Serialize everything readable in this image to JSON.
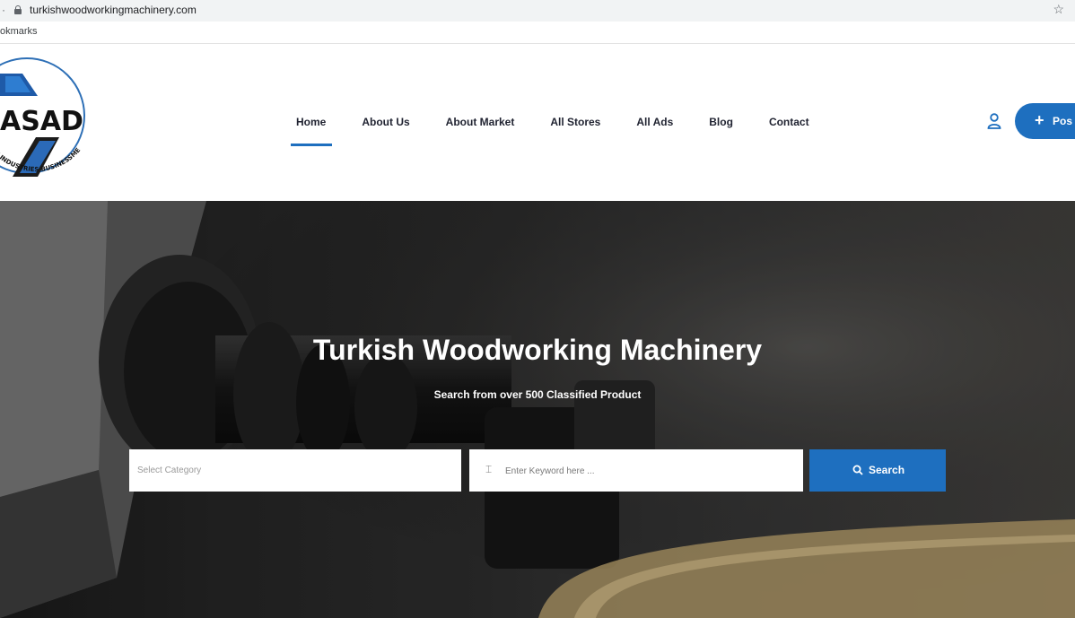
{
  "browser": {
    "url": "turkishwoodworkingmachinery.com",
    "bookmarks_label": "okmarks"
  },
  "logo": {
    "text": "ASAD",
    "ring_text": "DE INDUSTRIES BUSINESSMEN ASSOCIATION"
  },
  "nav": {
    "items": [
      {
        "label": "Home",
        "active": true
      },
      {
        "label": "About Us"
      },
      {
        "label": "About Market"
      },
      {
        "label": "All Stores"
      },
      {
        "label": "All Ads"
      },
      {
        "label": "Blog"
      },
      {
        "label": "Contact"
      }
    ]
  },
  "header_actions": {
    "post_label": "Pos"
  },
  "hero": {
    "title": "Turkish Woodworking Machinery",
    "subtitle": "Search from over 500 Classified Product"
  },
  "search": {
    "category_placeholder": "Select Category",
    "keyword_placeholder": "Enter Keyword here ...",
    "button_label": "Search"
  },
  "colors": {
    "accent": "#1e6fbf",
    "nav_text": "#1f2230"
  }
}
